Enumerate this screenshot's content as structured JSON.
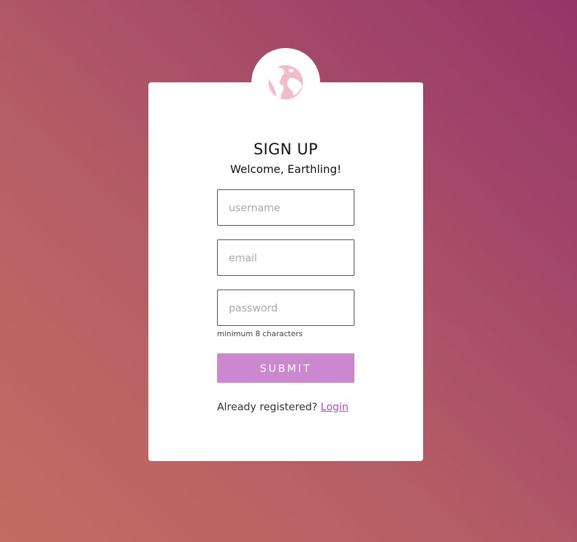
{
  "logo": {
    "icon": "globe-icon",
    "color": "#f2bcc8"
  },
  "form": {
    "title": "SIGN UP",
    "subtitle": "Welcome, Earthling!",
    "username_placeholder": "username",
    "email_placeholder": "email",
    "password_placeholder": "password",
    "password_hint": "minimum 8 characters",
    "submit_label": "SUBMIT",
    "submit_color": "#cc88cf",
    "footer_text": "Already registered?",
    "login_link": "Login",
    "link_color": "#b14fc0"
  }
}
